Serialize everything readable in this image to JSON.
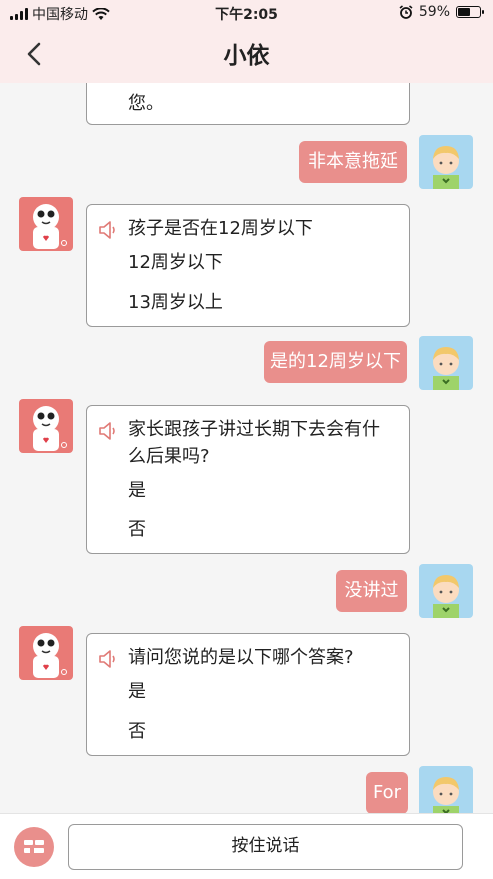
{
  "status_bar": {
    "carrier": "中国移动",
    "time": "下午2:05",
    "battery": "59%",
    "battery_level": 0.59
  },
  "header": {
    "title": "小依",
    "back_icon": "chevron-left-icon"
  },
  "chat": {
    "partial_top_text": "您。",
    "messages": [
      {
        "type": "user",
        "text": "非本意拖延"
      },
      {
        "type": "bot",
        "question": "孩子是否在12周岁以下",
        "options": [
          "12周岁以下",
          "13周岁以上"
        ]
      },
      {
        "type": "user",
        "text": "是的12周岁以下"
      },
      {
        "type": "bot",
        "question": "家长跟孩子讲过长期下去会有什么后果吗?",
        "options": [
          "是",
          "否"
        ]
      },
      {
        "type": "user",
        "text": "没讲过"
      },
      {
        "type": "bot",
        "question": "请问您说的是以下哪个答案?",
        "options": [
          "是",
          "否"
        ]
      },
      {
        "type": "user",
        "text": "For"
      }
    ]
  },
  "input": {
    "hold_to_talk": "按住说话",
    "keyboard_icon": "keyboard-icon"
  },
  "colors": {
    "header_bg": "#fbecec",
    "accent": "#e98f8c",
    "bot_avatar": "#e97a76",
    "user_avatar_bg": "#a8d7f0"
  }
}
